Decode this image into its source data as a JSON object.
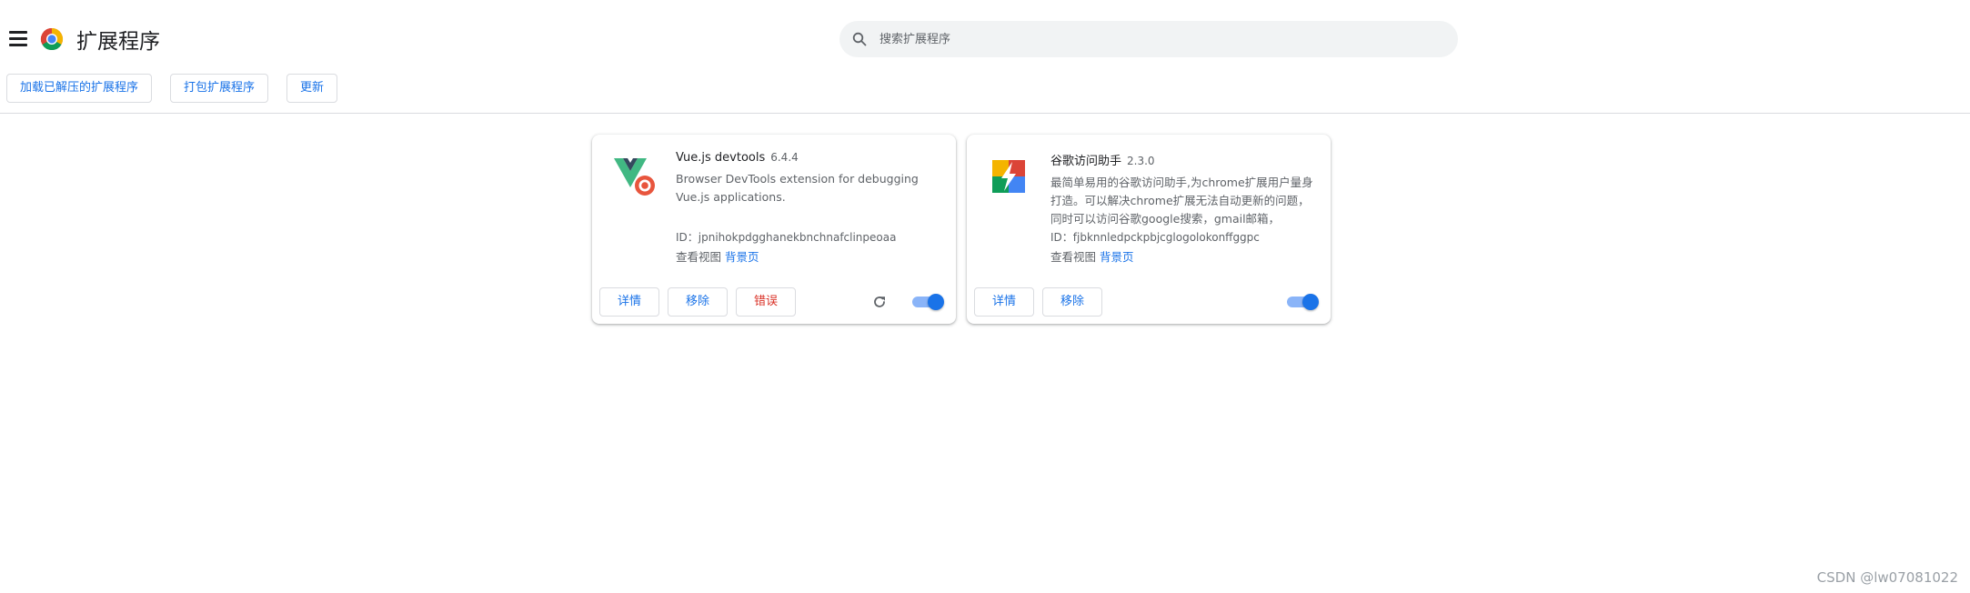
{
  "header": {
    "title": "扩展程序",
    "search_placeholder": "搜索扩展程序"
  },
  "toolbar": {
    "load_unpacked": "加载已解压的扩展程序",
    "pack": "打包扩展程序",
    "update": "更新"
  },
  "extensions": [
    {
      "name": "Vue.js devtools",
      "version": "6.4.4",
      "description": "Browser DevTools extension for debugging Vue.js applications.",
      "id": "ID：jpnihokpdgghanekbnchnafclinpeoaa",
      "views_label": "查看视图",
      "views_link": "背景页",
      "details": "详情",
      "remove": "移除",
      "errors": "错误",
      "enabled": true
    },
    {
      "name": "谷歌访问助手",
      "version": "2.3.0",
      "description": "最简单易用的谷歌访问助手,为chrome扩展用户量身打造。可以解决chrome扩展无法自动更新的问题，同时可以访问谷歌google搜索，gmail邮箱，",
      "id": "ID：fjbknnledpckpbjcglogolokonffggpc",
      "views_label": "查看视图",
      "views_link": "背景页",
      "details": "详情",
      "remove": "移除",
      "enabled": true
    }
  ],
  "watermark": "CSDN @lw07081022",
  "colors": {
    "accent": "#1a73e8",
    "error": "#d93025",
    "toggle_track": "#8ab4f8"
  }
}
